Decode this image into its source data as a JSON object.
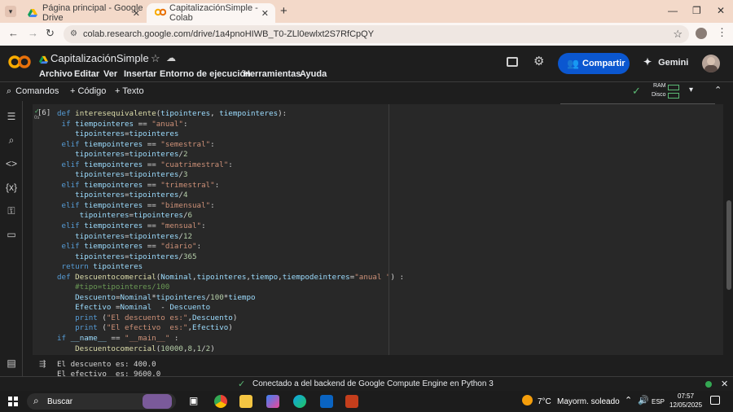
{
  "browser": {
    "tabs": [
      {
        "label": "Página principal - Google Drive",
        "active": false
      },
      {
        "label": "CapitalizaciónSimple - Colab",
        "active": true
      }
    ],
    "new_tab": "+",
    "url": "colab.research.google.com/drive/1a4pnoHIWB_T0-ZLl0ewlxt2S7RfCpQY"
  },
  "colab": {
    "title": "CapitalizaciónSimple",
    "menu": [
      "Archivo",
      "Editar",
      "Ver",
      "Insertar",
      "Entorno de ejecución",
      "Herramientas",
      "Ayuda"
    ],
    "share_label": "Compartir",
    "gemini_label": "Gemini",
    "toolbar": {
      "commands": "Comandos",
      "add_code": "+ Código",
      "add_text": "+ Texto",
      "ram_label": "RAM",
      "disk_label": "Disco"
    },
    "cell": {
      "exec_count": "[6]",
      "code_lines": [
        "def interesequivalente(tipointeres, tiempointeres):",
        " if tiempointeres == \"anual\":",
        "    tipointeres=tipointeres",
        " elif tiempointeres == \"semestral\":",
        "    tipointeres=tipointeres/2",
        " elif tiempointeres == \"cuatrimestral\":",
        "    tipointeres=tipointeres/3",
        " elif tiempointeres == \"trimestral\":",
        "    tipointeres=tipointeres/4",
        " elif tiempointeres == \"bimensual\":",
        "     tipointeres=tipointeres/6",
        " elif tiempointeres == \"mensual\":",
        "    tipointeres=tipointeres/12",
        " elif tiempointeres == \"diario\":",
        "    tipointeres=tipointeres/365",
        " return tipointeres",
        "def Descuentocomercial(Nominal,tipointeres,tiempo,tiempodeinteres=\"anual \") :",
        "    #tipo=tipointeres/100",
        "    Descuento=Nominal*tipointeres/100*tiempo",
        "    Efectivo =Nominal  - Descuento",
        "    print (\"El descuento es:\",Descuento)",
        "    print (\"El efectivo  es:\",Efectivo)",
        "if __name__ == \"__main__\" :",
        "    Descuentocomercial(10000,8,1/2)"
      ],
      "output_lines": [
        "El descuento es: 400.0",
        "El efectivo  es: 9600.0"
      ]
    },
    "status": "Conectado a del backend de Google Compute Engine en Python 3"
  },
  "taskbar": {
    "search": "Buscar",
    "weather_temp": "7°C",
    "weather_text": "Mayorm. soleado",
    "lang": "ESP",
    "time": "07:57",
    "date": "12/05/2025"
  },
  "colors": {
    "accent": "#1a73e8",
    "share_bg": "#0b57d0",
    "bg_dark": "#1e1e1e",
    "cell_bg": "#282828"
  }
}
